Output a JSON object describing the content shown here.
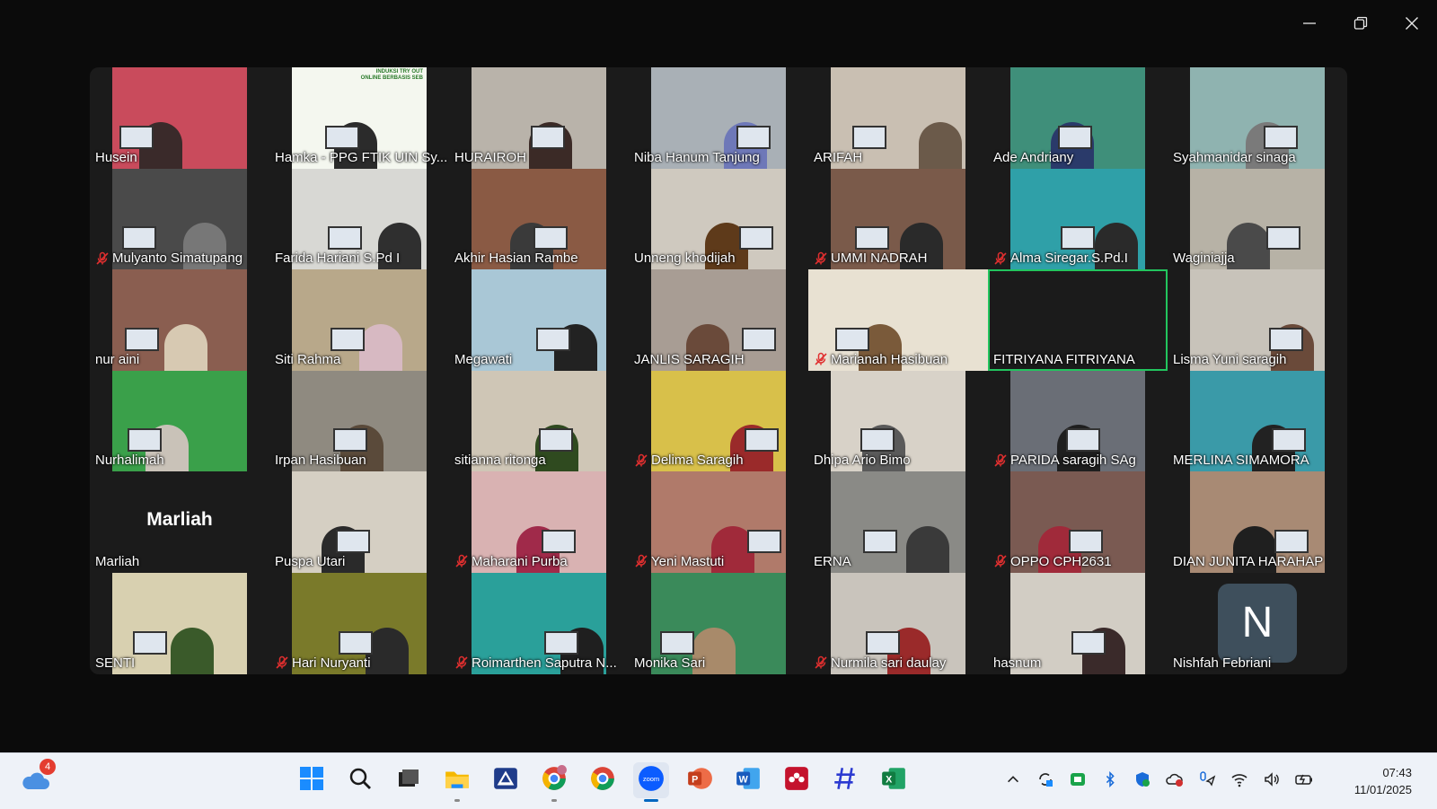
{
  "window": {
    "controls": [
      "minimize-icon",
      "restore-icon",
      "close-icon"
    ]
  },
  "gallery": {
    "speaking_color": "#22c55e",
    "participants": [
      {
        "name": "Husein",
        "muted": false,
        "bg": "#c94b5c",
        "fig": "#3a2a2a"
      },
      {
        "name": "Hamka - PPG FTIK UIN Sy...",
        "muted": false,
        "bg": "#f4f7ef",
        "fig": "#2b2b2b",
        "slide": "INDUKSI TRY OUT ONLINE BERBASIS SEB"
      },
      {
        "name": "HURAIROH",
        "muted": false,
        "bg": "#b9b3aa",
        "fig": "#3b2a26"
      },
      {
        "name": "Niba Hanum Tanjung",
        "muted": false,
        "bg": "#a9b0b6",
        "fig": "#6e78b8"
      },
      {
        "name": "ARIFAH",
        "muted": false,
        "bg": "#c9bfb2",
        "fig": "#6b5a4a"
      },
      {
        "name": "Ade Andriany",
        "muted": false,
        "bg": "#3f8f7a",
        "fig": "#2a3a6a"
      },
      {
        "name": "Syahmanidar sinaga",
        "muted": false,
        "bg": "#8fb3b0",
        "fig": "#7a7a7a"
      },
      {
        "name": "Mulyanto Simatupang",
        "muted": true,
        "bg": "#4a4a4a",
        "fig": "#777777"
      },
      {
        "name": "Farida Hariani S.Pd I",
        "muted": false,
        "bg": "#d8d8d4",
        "fig": "#2f2f2f"
      },
      {
        "name": "Akhir Hasian Rambe",
        "muted": false,
        "bg": "#8a5a44",
        "fig": "#3a3a3a"
      },
      {
        "name": "Unneng khodijah",
        "muted": false,
        "bg": "#cfc9bf",
        "fig": "#5e3a1a"
      },
      {
        "name": "UMMI NADRAH",
        "muted": true,
        "bg": "#7a5a4a",
        "fig": "#2a2a2a"
      },
      {
        "name": "Alma Siregar.S.Pd.I",
        "muted": true,
        "bg": "#2fa0a8",
        "fig": "#2a2a2a"
      },
      {
        "name": "Waginiajja",
        "muted": false,
        "bg": "#b7b2a6",
        "fig": "#4a4a4a"
      },
      {
        "name": "nur aini",
        "muted": false,
        "bg": "#8a5e50",
        "fig": "#d7c9b2"
      },
      {
        "name": "Siti Rahma",
        "muted": false,
        "bg": "#b8a88a",
        "fig": "#d7b9c2"
      },
      {
        "name": "Megawati",
        "muted": false,
        "bg": "#a9c7d6",
        "fig": "#222222"
      },
      {
        "name": "JANLIS SARAGIH",
        "muted": false,
        "bg": "#a89d94",
        "fig": "#6a4a3a"
      },
      {
        "name": "Marianah Hasibuan",
        "muted": true,
        "bg": "#e8e1d2",
        "fig": "#7a5a3a",
        "full": true
      },
      {
        "name": "FITRIYANA FITRIYANA",
        "muted": false,
        "bg": "#1b1b1b",
        "fig": "",
        "speaking": true,
        "full": true
      },
      {
        "name": "Lisma Yuni saragih",
        "muted": false,
        "bg": "#c8c3ba",
        "fig": "#6a4a3a"
      },
      {
        "name": "Nurhalimah",
        "muted": false,
        "bg": "#3aa04a",
        "fig": "#c9c2b8"
      },
      {
        "name": "Irpan Hasibuan",
        "muted": false,
        "bg": "#8f8a80",
        "fig": "#5a4a3a"
      },
      {
        "name": "sitianna ritonga",
        "muted": false,
        "bg": "#cfc6b6",
        "fig": "#2f4a1f"
      },
      {
        "name": "Delima Saragih",
        "muted": true,
        "bg": "#d8c04a",
        "fig": "#9a2a2a"
      },
      {
        "name": "Dhipa Ario Bimo",
        "muted": false,
        "bg": "#d8d2c8",
        "fig": "#5a5a5a"
      },
      {
        "name": "PARIDA saragih SAg",
        "muted": true,
        "bg": "#6a6e76",
        "fig": "#1f1f1f"
      },
      {
        "name": "MERLINA SIMAMORA",
        "muted": false,
        "bg": "#3a9aa8",
        "fig": "#222222"
      },
      {
        "name": "Marliah",
        "muted": false,
        "bg": "#1b1b1b",
        "fig": "",
        "label_only": "Marliah"
      },
      {
        "name": "Puspa Utari",
        "muted": false,
        "bg": "#d5cfc3",
        "fig": "#2a2a2a"
      },
      {
        "name": "Maharani Purba",
        "muted": true,
        "bg": "#d9b2b2",
        "fig": "#a02a4a"
      },
      {
        "name": "Yeni Mastuti",
        "muted": true,
        "bg": "#b07a6a",
        "fig": "#a02a3a"
      },
      {
        "name": "ERNA",
        "muted": false,
        "bg": "#8a8a86",
        "fig": "#3a3a3a"
      },
      {
        "name": "OPPO CPH2631",
        "muted": true,
        "bg": "#7a5a52",
        "fig": "#a02a3a"
      },
      {
        "name": "DIAN JUNITA HARAHAP",
        "muted": false,
        "bg": "#a88a74",
        "fig": "#1f1f1f"
      },
      {
        "name": "SENTI",
        "muted": false,
        "bg": "#d8d0b0",
        "fig": "#3a5a2a"
      },
      {
        "name": "Hari Nuryanti",
        "muted": true,
        "bg": "#7a7a2a",
        "fig": "#2a2a2a"
      },
      {
        "name": "Roimarthen Saputra N...",
        "muted": true,
        "bg": "#2aa09a",
        "fig": "#1f1f1f"
      },
      {
        "name": "Monika Sari",
        "muted": false,
        "bg": "#3a8a5a",
        "fig": "#a88a6a"
      },
      {
        "name": "Nurmila sari daulay",
        "muted": true,
        "bg": "#c9c4bc",
        "fig": "#9a2a2a"
      },
      {
        "name": "hasnum",
        "muted": false,
        "bg": "#d2cdc4",
        "fig": "#3a2a2a"
      },
      {
        "name": "Nishfah Febriani",
        "muted": false,
        "bg": "#1b1b1b",
        "fig": "",
        "avatar": "N"
      }
    ]
  },
  "taskbar": {
    "weather_badge": "4",
    "apps": [
      {
        "name": "start-icon",
        "active": false,
        "running": false
      },
      {
        "name": "search-icon",
        "active": false,
        "running": false
      },
      {
        "name": "task-view-icon",
        "active": false,
        "running": false
      },
      {
        "name": "file-explorer-icon",
        "active": false,
        "running": true
      },
      {
        "name": "photos-app-icon",
        "active": false,
        "running": false
      },
      {
        "name": "chrome-profile-icon",
        "active": false,
        "running": true
      },
      {
        "name": "chrome-icon",
        "active": false,
        "running": false
      },
      {
        "name": "zoom-icon",
        "active": true,
        "running": true,
        "label": "zoom"
      },
      {
        "name": "powerpoint-icon",
        "active": false,
        "running": false
      },
      {
        "name": "word-icon",
        "active": false,
        "running": false
      },
      {
        "name": "mendeley-icon",
        "active": false,
        "running": false
      },
      {
        "name": "slash-app-icon",
        "active": false,
        "running": false
      },
      {
        "name": "excel-icon",
        "active": false,
        "running": false
      }
    ],
    "tray": [
      "chevron-up-icon",
      "sync-icon",
      "green-app-icon",
      "bluetooth-icon",
      "defender-icon",
      "onedrive-error-icon",
      "mic-location-icon",
      "wifi-icon",
      "volume-icon",
      "battery-icon"
    ],
    "time": "07:43",
    "date": "11/01/2025"
  }
}
